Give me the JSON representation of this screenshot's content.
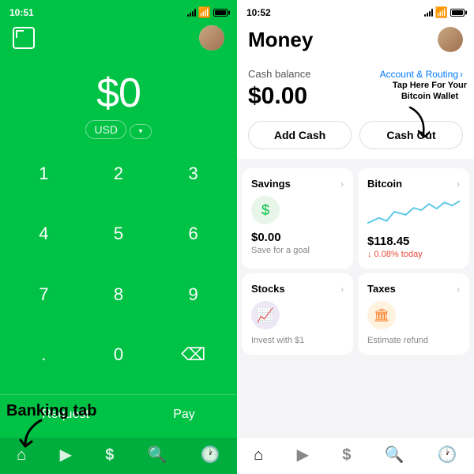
{
  "left": {
    "status": {
      "time": "10:51",
      "signal": true,
      "wifi": true,
      "battery": true
    },
    "amount": "$0",
    "currency": "USD",
    "numpad": [
      "1",
      "2",
      "3",
      "4",
      "5",
      "6",
      "7",
      "8",
      "9",
      ".",
      "0",
      "⌫"
    ],
    "actions": {
      "request": "Request",
      "pay": "Pay"
    },
    "nav": [
      {
        "icon": "🏠",
        "label": "home",
        "active": true
      },
      {
        "icon": "▶",
        "label": "activity"
      },
      {
        "icon": "$",
        "label": "cash"
      },
      {
        "icon": "🔍",
        "label": "search"
      },
      {
        "icon": "🕐",
        "label": "history"
      }
    ],
    "annotation": {
      "text": "Banking tab",
      "arrow": "↙"
    }
  },
  "right": {
    "status": {
      "time": "10:52",
      "signal": true,
      "wifi": true,
      "battery": true
    },
    "title": "Money",
    "cash_balance": {
      "label": "Cash balance",
      "account_routing": "Account & Routing",
      "amount": "$0.00"
    },
    "tap_annotation": "Tap Here For Your Bitcoin Wallet",
    "buttons": {
      "add_cash": "Add Cash",
      "cash_out": "Cash Out"
    },
    "cards": [
      {
        "title": "Savings",
        "icon": "savings",
        "amount": "$0.00",
        "subtitle": "Save for a goal",
        "has_chart": false
      },
      {
        "title": "Bitcoin",
        "icon": "bitcoin",
        "amount": "$118.45",
        "subtitle": "0.08% today",
        "has_chart": true
      },
      {
        "title": "Stocks",
        "icon": "stocks",
        "amount": "",
        "subtitle": "Invest with $1",
        "has_chart": false
      },
      {
        "title": "Taxes",
        "icon": "taxes",
        "amount": "",
        "subtitle": "Estimate refund",
        "has_chart": false
      }
    ],
    "nav": [
      {
        "icon": "home",
        "active": true
      },
      {
        "icon": "activity"
      },
      {
        "icon": "cash"
      },
      {
        "icon": "search"
      },
      {
        "icon": "history"
      }
    ]
  }
}
